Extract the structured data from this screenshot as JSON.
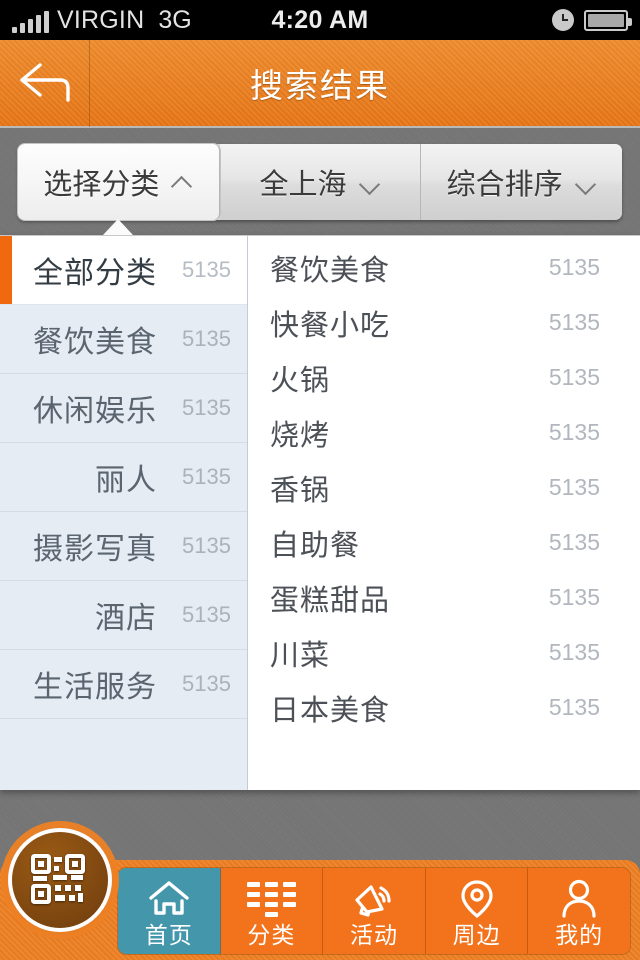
{
  "status_bar": {
    "carrier": "VIRGIN",
    "network": "3G",
    "time": "4:20 AM",
    "signal_icon": "signal-bars-icon",
    "alarm_icon": "clock-icon",
    "battery_icon": "battery-icon"
  },
  "header": {
    "back_icon": "back-arrow-icon",
    "title": "搜索结果"
  },
  "filter_bar": {
    "buttons": [
      {
        "label": "选择分类",
        "chevron": "chevron-up-icon",
        "active": true
      },
      {
        "label": "全上海",
        "chevron": "chevron-down-icon",
        "active": false
      },
      {
        "label": "综合排序",
        "chevron": "chevron-down-icon",
        "active": false
      }
    ]
  },
  "dropdown": {
    "categories": [
      {
        "name": "全部分类",
        "count": "5135",
        "selected": true
      },
      {
        "name": "餐饮美食",
        "count": "5135",
        "selected": false
      },
      {
        "name": "休闲娱乐",
        "count": "5135",
        "selected": false
      },
      {
        "name": "丽人",
        "count": "5135",
        "selected": false
      },
      {
        "name": "摄影写真",
        "count": "5135",
        "selected": false
      },
      {
        "name": "酒店",
        "count": "5135",
        "selected": false
      },
      {
        "name": "生活服务",
        "count": "5135",
        "selected": false
      }
    ],
    "subcategories": [
      {
        "name": "餐饮美食",
        "count": "5135"
      },
      {
        "name": "快餐小吃",
        "count": "5135"
      },
      {
        "name": "火锅",
        "count": "5135"
      },
      {
        "name": "烧烤",
        "count": "5135"
      },
      {
        "name": "香锅",
        "count": "5135"
      },
      {
        "name": "自助餐",
        "count": "5135"
      },
      {
        "name": "蛋糕甜品",
        "count": "5135"
      },
      {
        "name": "川菜",
        "count": "5135"
      },
      {
        "name": "日本美食",
        "count": "5135"
      }
    ]
  },
  "tab_bar": {
    "scan_button_icon": "qr-code-icon",
    "tabs": [
      {
        "label": "首页",
        "icon": "home-icon",
        "active": true
      },
      {
        "label": "分类",
        "icon": "grid-list-icon",
        "active": false
      },
      {
        "label": "活动",
        "icon": "megaphone-icon",
        "active": false
      },
      {
        "label": "周边",
        "icon": "map-pin-icon",
        "active": false
      },
      {
        "label": "我的",
        "icon": "user-icon",
        "active": false
      }
    ]
  },
  "colors": {
    "brand_orange": "#ee8124",
    "accent_orange": "#f0690f",
    "active_tab_teal": "#4497ab",
    "panel_blue_grey": "#e6ecf4",
    "backdrop_grey": "#757575"
  }
}
